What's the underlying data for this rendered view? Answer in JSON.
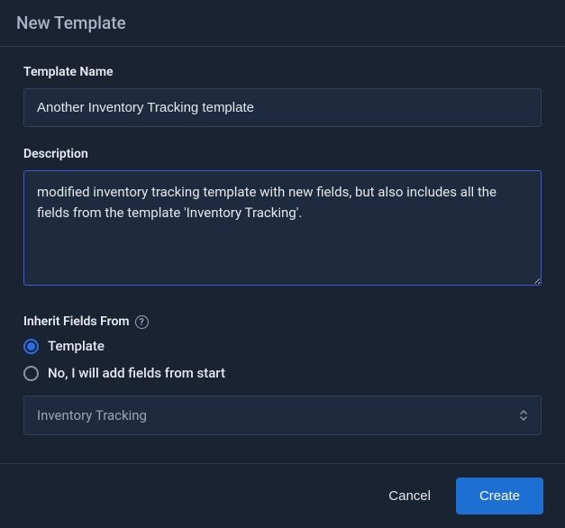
{
  "header": {
    "title": "New Template"
  },
  "form": {
    "name": {
      "label": "Template Name",
      "value": "Another Inventory Tracking template"
    },
    "description": {
      "label": "Description",
      "value": "modified inventory tracking template with new fields, but also includes all the fields from the template 'Inventory Tracking'."
    },
    "inherit": {
      "label": "Inherit Fields From",
      "options": {
        "template": "Template",
        "none": "No, I will add fields from start"
      },
      "selected": "template",
      "source_value": "Inventory Tracking"
    }
  },
  "footer": {
    "cancel": "Cancel",
    "create": "Create"
  }
}
